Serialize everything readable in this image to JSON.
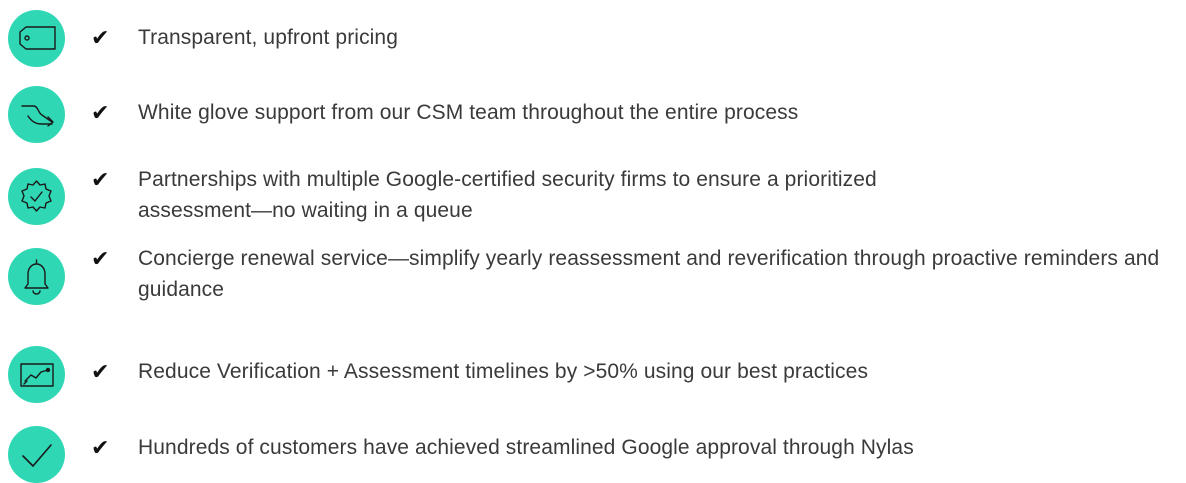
{
  "check_glyph": "✔",
  "accent_color": "#2fd7b4",
  "items": [
    {
      "icon": "price-tag-icon",
      "text": "Transparent, upfront pricing"
    },
    {
      "icon": "route-arrows-icon",
      "text": "White glove support from our CSM team throughout the entire process"
    },
    {
      "icon": "verified-badge-icon",
      "text": "Partnerships with multiple Google-certified security firms to ensure a prioritized assessment—no waiting in a queue"
    },
    {
      "icon": "bell-icon",
      "text": "Concierge renewal service—simplify yearly reassessment and reverification through proactive reminders and guidance"
    },
    {
      "icon": "line-chart-icon",
      "text": "Reduce Verification + Assessment timelines by >50% using our best practices"
    },
    {
      "icon": "checkmark-icon",
      "text": "Hundreds of customers have achieved streamlined Google approval through Nylas"
    }
  ]
}
